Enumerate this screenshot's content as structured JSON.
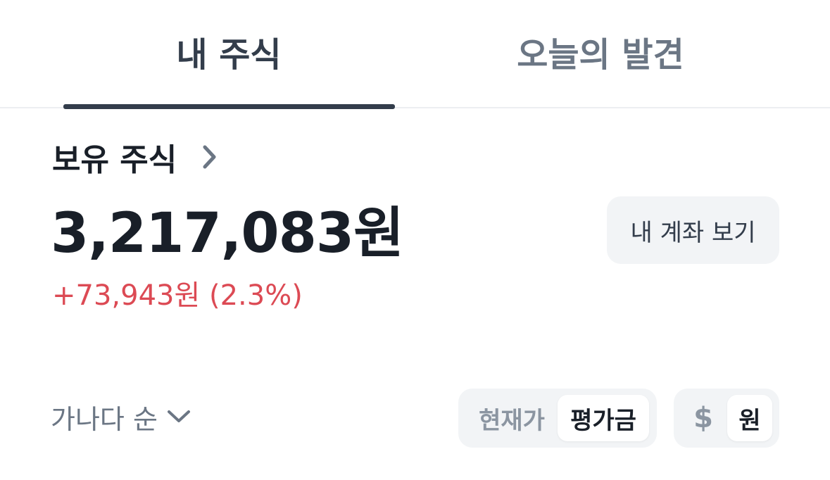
{
  "tabs": [
    {
      "label": "내 주식",
      "active": true
    },
    {
      "label": "오늘의 발견",
      "active": false
    }
  ],
  "holdings": {
    "title": "보유 주식",
    "total_amount": "3,217,083원",
    "profit": "+73,943원 (2.3%)",
    "account_button": "내 계좌 보기"
  },
  "sort": {
    "label": "가나다 순"
  },
  "price_toggle": {
    "options": [
      "현재가",
      "평가금"
    ],
    "selected": "평가금"
  },
  "currency_toggle": {
    "options": [
      "$",
      "원"
    ],
    "selected": "원"
  },
  "colors": {
    "text_primary": "#191f28",
    "text_secondary": "#6b7684",
    "profit_red": "#dc4a54",
    "button_bg": "#f2f4f6",
    "tab_indicator": "#333d4b"
  },
  "icons": {
    "holdings_chevron": "chevron-right-icon",
    "sort_chevron": "chevron-down-icon"
  }
}
